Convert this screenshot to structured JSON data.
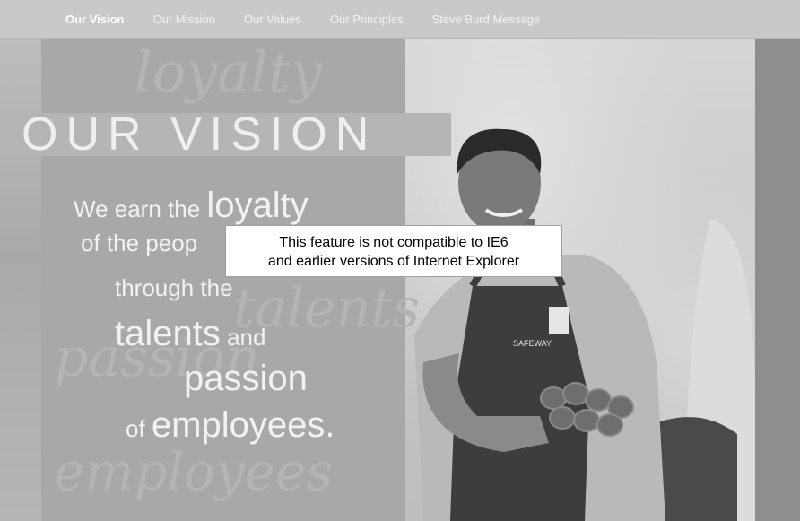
{
  "nav": {
    "items": [
      {
        "label": "Our Vision",
        "active": true
      },
      {
        "label": "Our Mission",
        "active": false
      },
      {
        "label": "Our Values",
        "active": false
      },
      {
        "label": "Our Principles",
        "active": false
      },
      {
        "label": "Steve Burd Message",
        "active": false
      }
    ]
  },
  "hero": {
    "title": "OUR VISION",
    "watermarks": {
      "top": "loyalty",
      "middle1": "talents",
      "middle2": "passion",
      "bottom": "employees"
    },
    "statement": {
      "l1a": "We earn the ",
      "l1b": "loyalty",
      "l2": "of the peop",
      "l3": "through the",
      "l4a": "talents",
      "l4b": " and",
      "l5": "passion",
      "l6a": "of ",
      "l6b": "employees."
    },
    "apron_text": "SAFEWAY"
  },
  "notice": {
    "line1": "This feature is not compatible to IE6",
    "line2": "and earlier versions of Internet Explorer"
  },
  "colors": {
    "notice_bg": "#ffffff",
    "text_light": "#f2f2f2",
    "panel": "#a8a8a8"
  }
}
